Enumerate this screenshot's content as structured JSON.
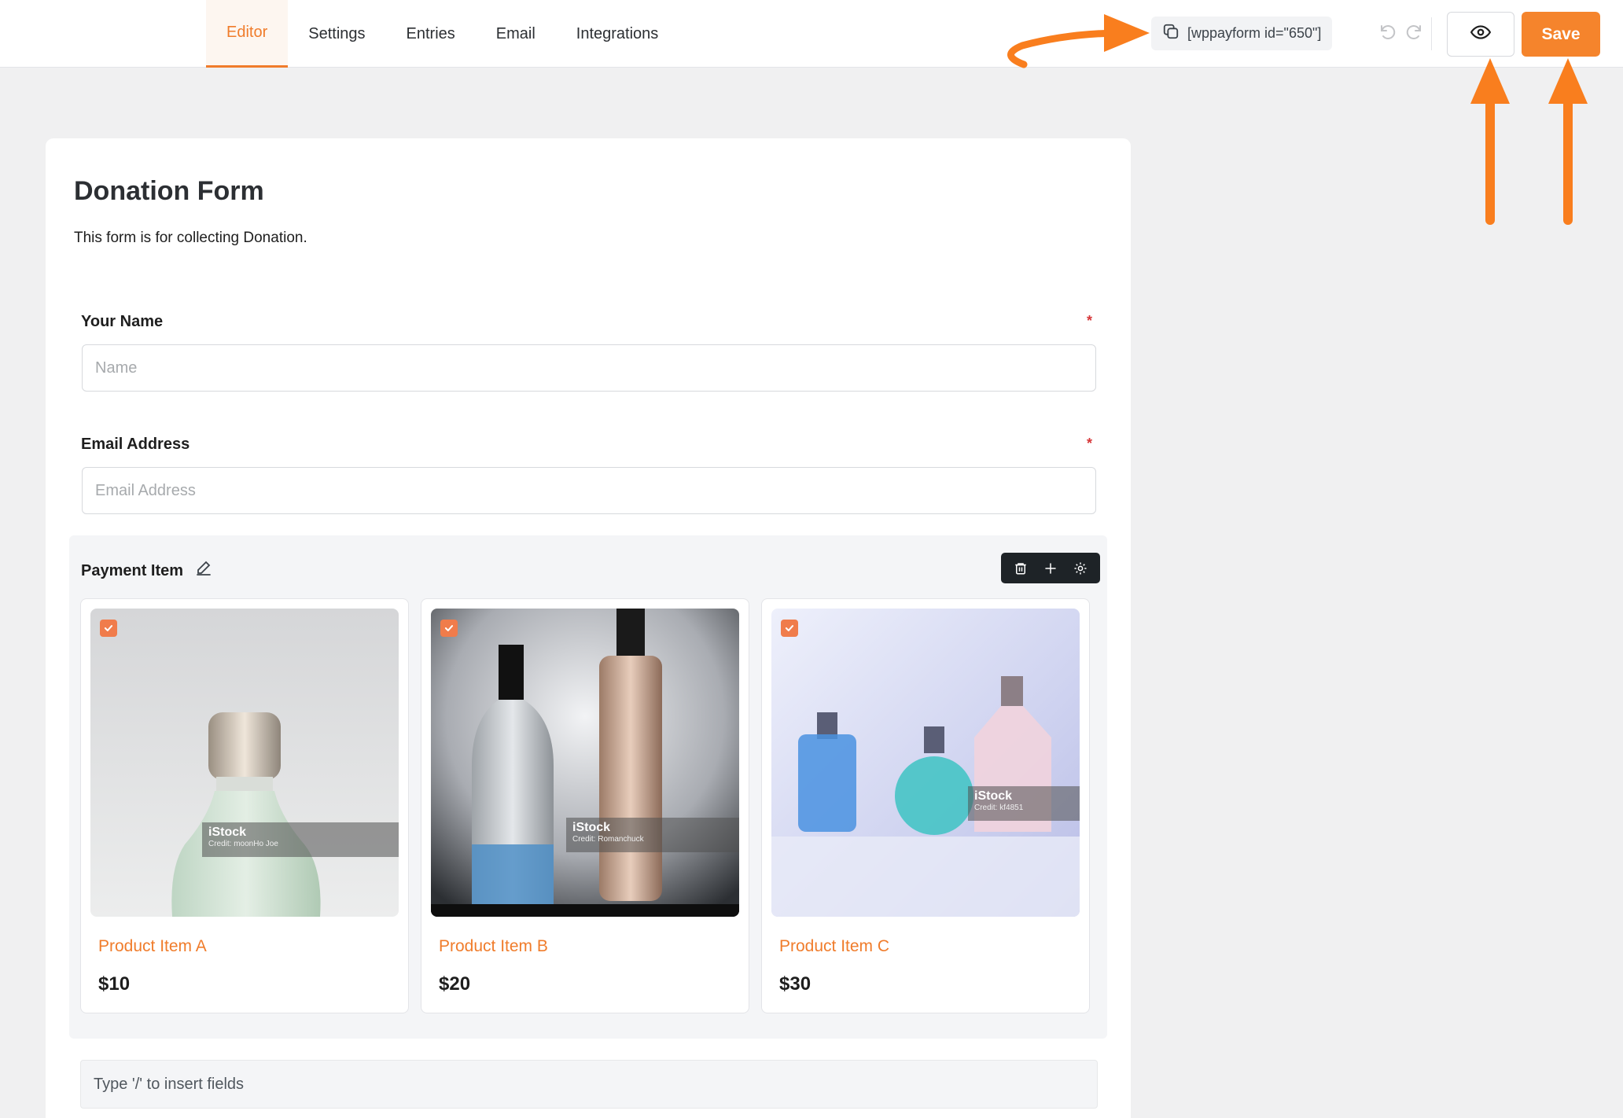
{
  "topbar": {
    "tabs": [
      {
        "label": "Editor",
        "active": true
      },
      {
        "label": "Settings",
        "active": false
      },
      {
        "label": "Entries",
        "active": false
      },
      {
        "label": "Email",
        "active": false
      },
      {
        "label": "Integrations",
        "active": false
      }
    ],
    "shortcode": "[wppayform id=\"650\"]",
    "save_label": "Save",
    "icons": {
      "copy": "copy-icon",
      "undo": "undo-icon",
      "redo": "redo-icon",
      "preview": "eye-icon"
    }
  },
  "form": {
    "title": "Donation Form",
    "description": "This form is for collecting Donation.",
    "fields": {
      "name": {
        "label": "Your Name",
        "required_mark": "*",
        "placeholder": "Name"
      },
      "email": {
        "label": "Email Address",
        "required_mark": "*",
        "placeholder": "Email Address"
      }
    },
    "payment": {
      "label": "Payment Item",
      "products": [
        {
          "name": "Product Item A",
          "price": "$10",
          "checked": true,
          "watermark": "iStock",
          "credit": "Credit: moonHo Joe"
        },
        {
          "name": "Product Item B",
          "price": "$20",
          "checked": true,
          "watermark": "iStock",
          "credit": "Credit: Romanchuck"
        },
        {
          "name": "Product Item C",
          "price": "$30",
          "checked": true,
          "watermark": "iStock",
          "credit": "Credit: kf4851"
        }
      ]
    },
    "insert_hint": "Type '/' to insert fields"
  },
  "colors": {
    "accent": "#f07c2b",
    "save_button": "#f5842c",
    "annotation_arrow": "#f97e1e",
    "required": "#d63638",
    "toolbar_dark": "#1e2327"
  }
}
